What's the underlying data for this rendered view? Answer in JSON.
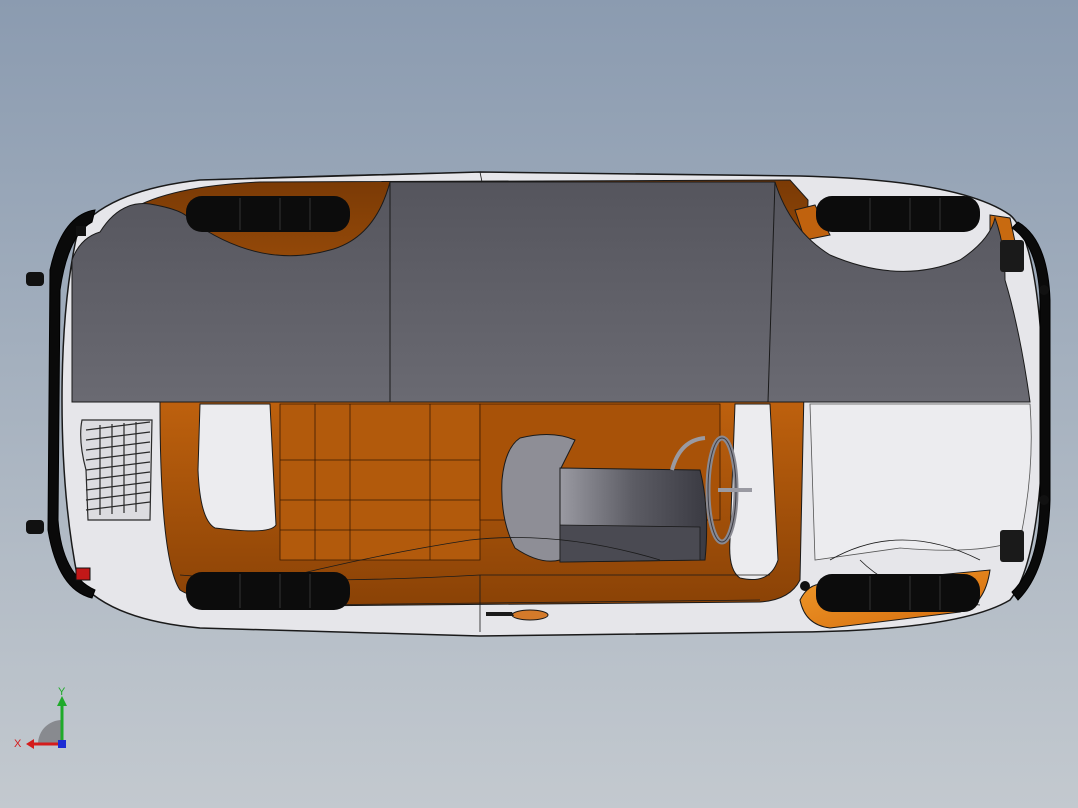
{
  "view": {
    "background_top": "#8b9bb0",
    "background_bottom": "#c3c9cf"
  },
  "model": {
    "body_color": "#b85a0a",
    "body_highlight": "#e8861e",
    "cover_color": "#5e5e66",
    "tire_color": "#0c0c0c",
    "edge_color": "#1a1a1a"
  },
  "triad": {
    "x_label": "X",
    "y_label": "Y",
    "x_color": "#d41c1c",
    "y_color": "#1faa2a",
    "z_color": "#1c2cd4"
  }
}
